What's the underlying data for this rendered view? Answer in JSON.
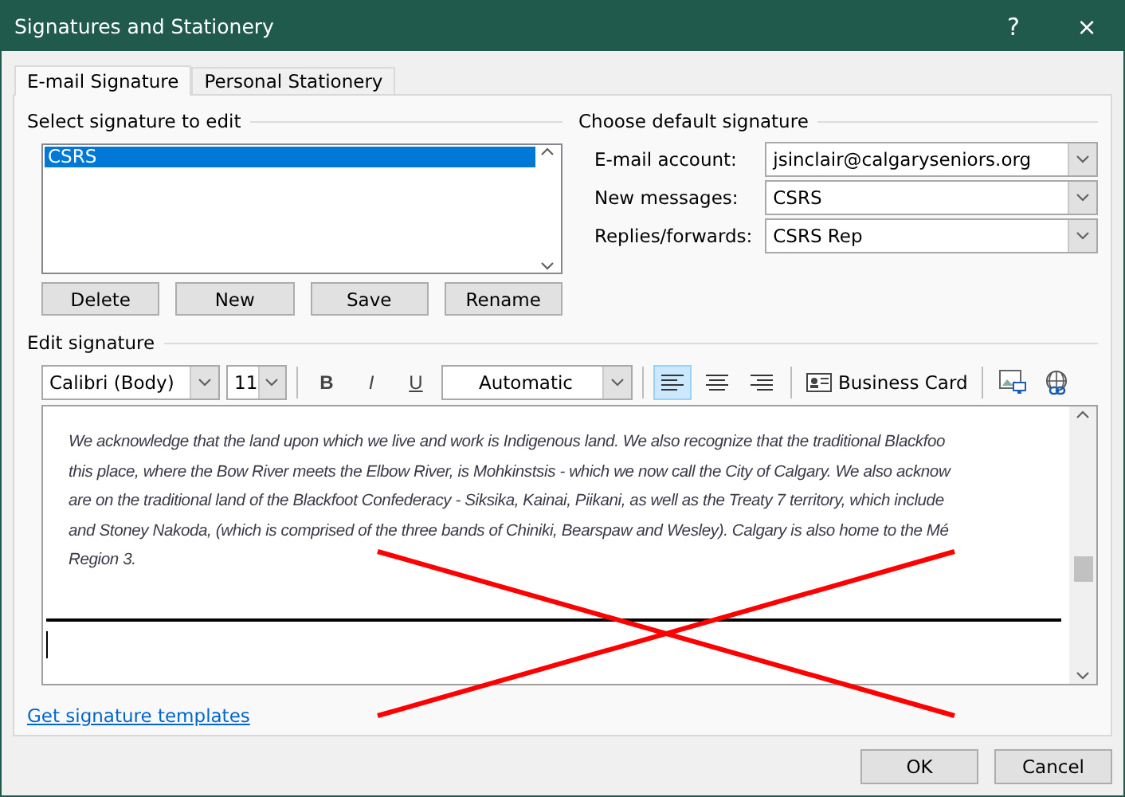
{
  "window": {
    "title": "Signatures and Stationery",
    "help": "?",
    "close": "×"
  },
  "tabs": [
    {
      "label": "E-mail Signature",
      "selected": true
    },
    {
      "label": "Personal Stationery",
      "selected": false
    }
  ],
  "select_signature": {
    "heading": "Select signature to edit",
    "items": [
      {
        "label": "CSRS",
        "selected": true
      }
    ],
    "buttons": [
      "Delete",
      "New",
      "Save",
      "Rename"
    ]
  },
  "default_signature": {
    "heading": "Choose default signature",
    "fields": [
      {
        "label": "E-mail account:",
        "value": "jsinclair@calgaryseniors.org"
      },
      {
        "label": "New messages:",
        "value": "CSRS"
      },
      {
        "label": "Replies/forwards:",
        "value": "CSRS Rep"
      }
    ]
  },
  "edit_signature": {
    "heading": "Edit signature",
    "toolbar": {
      "font": "Calibri (Body)",
      "size": "11",
      "format_buttons": [
        {
          "kind": "bold",
          "label": "B"
        },
        {
          "kind": "italic",
          "label": "I"
        },
        {
          "kind": "underline",
          "label": "U"
        }
      ],
      "font_color_setting": "Automatic",
      "alignments": [
        {
          "kind": "left",
          "selected": true
        },
        {
          "kind": "center",
          "selected": false
        },
        {
          "kind": "right",
          "selected": false
        }
      ],
      "business_card": "Business Card"
    },
    "body_lines": [
      "We acknowledge that the land upon which we live and work is Indigenous land. We also recognize that the traditional Blackfoo",
      "this place, where the Bow River meets the Elbow River, is Mohkinstsis - which we now call the City of Calgary. We also acknow",
      "are on the traditional land of the Blackfoot Confederacy - Siksika, Kainai, Piikani, as well as the Treaty 7 territory, which include",
      "and Stoney Nakoda, (which is comprised of the three bands of Chiniki, Bearspaw and Wesley). Calgary is also home to the Mé",
      "Region 3."
    ]
  },
  "link": "Get signature templates",
  "buttons": [
    "OK",
    "Cancel"
  ]
}
